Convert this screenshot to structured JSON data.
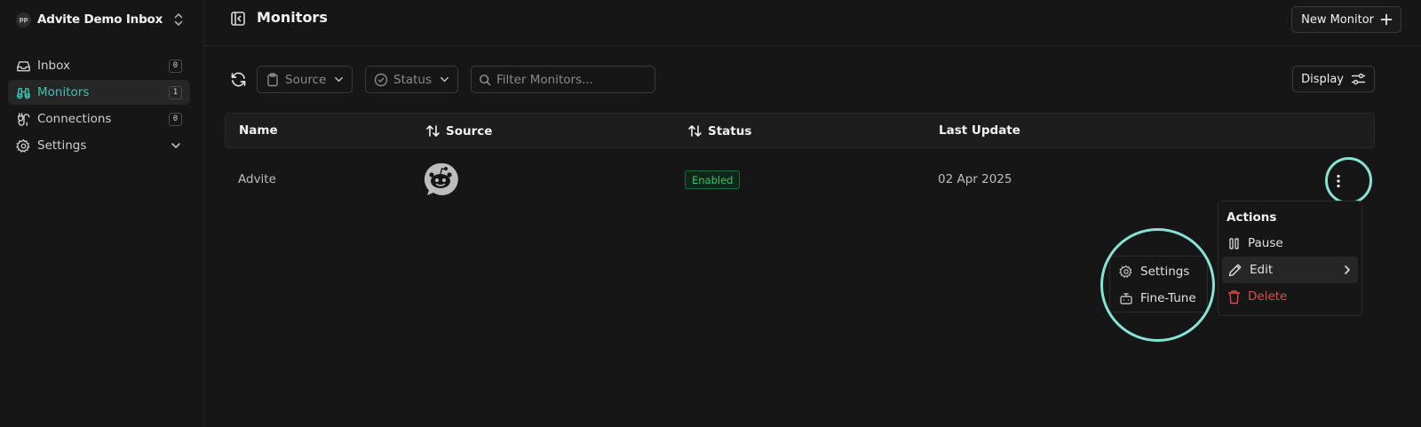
{
  "workspace": {
    "name": "Advite Demo Inbox",
    "avatar_initials": "pp"
  },
  "sidebar": {
    "items": [
      {
        "label": "Inbox",
        "badge": "0",
        "icon": "inbox-icon"
      },
      {
        "label": "Monitors",
        "badge": "1",
        "icon": "binoculars-icon",
        "active": true
      },
      {
        "label": "Connections",
        "badge": "0",
        "icon": "cable-icon"
      },
      {
        "label": "Settings",
        "icon": "gear-icon"
      }
    ]
  },
  "header": {
    "title": "Monitors",
    "new_button": "New Monitor"
  },
  "toolbar": {
    "source_filter": "Source",
    "status_filter": "Status",
    "search_placeholder": "Filter Monitors...",
    "display_button": "Display"
  },
  "table": {
    "columns": [
      "Name",
      "Source",
      "Status",
      "Last Update"
    ],
    "rows": [
      {
        "name": "Advite",
        "source_icon": "reddit-icon",
        "status": "Enabled",
        "last_update": "02 Apr 2025"
      }
    ]
  },
  "actions_menu": {
    "title": "Actions",
    "items": [
      "Pause",
      "Edit",
      "Delete"
    ]
  },
  "edit_submenu": {
    "items": [
      "Settings",
      "Fine-Tune"
    ]
  },
  "colors": {
    "accent": "#38c6b3",
    "ring": "#86e3d5",
    "enabled": "#2ec76a",
    "danger": "#e5484d"
  }
}
